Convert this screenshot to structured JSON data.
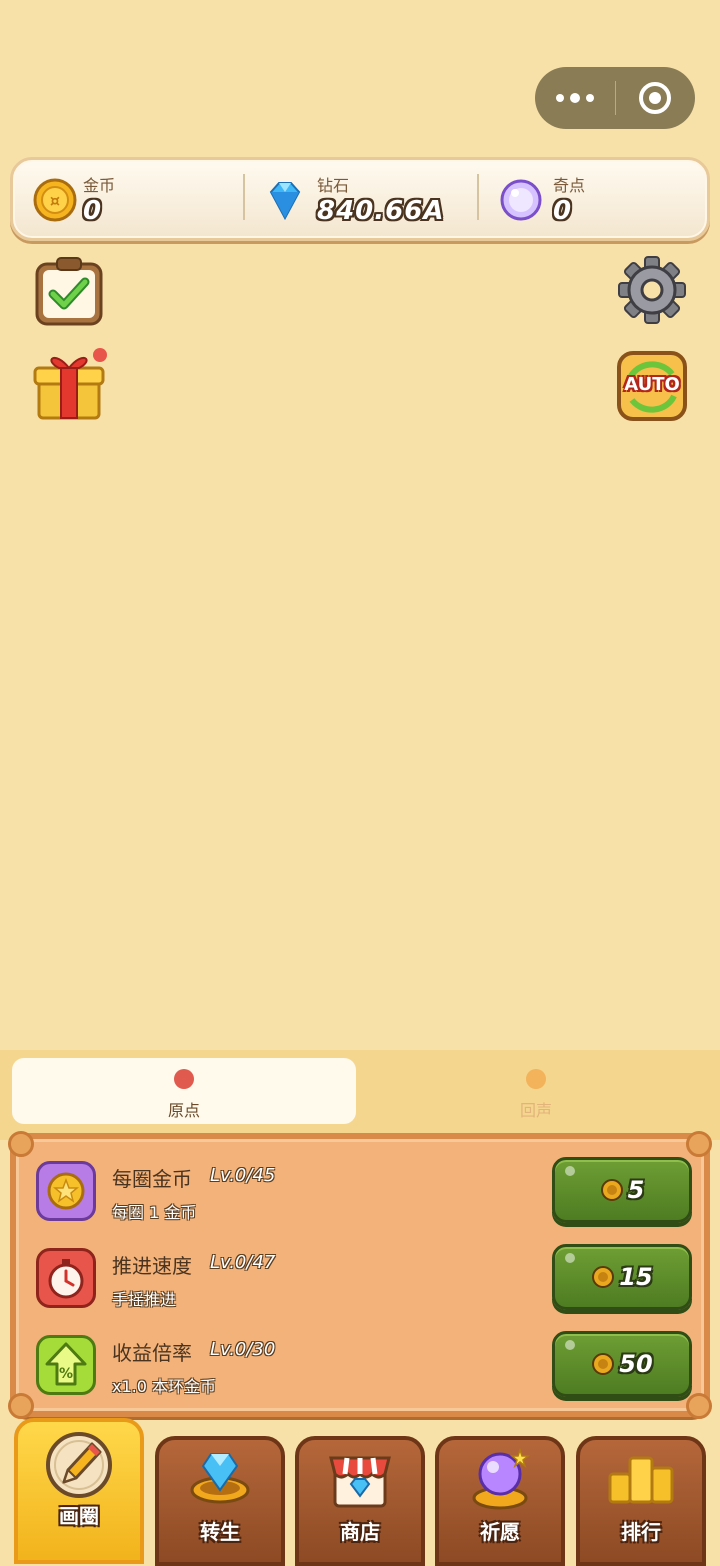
{
  "top_bar": {
    "more_icon": "more-dots-icon",
    "close_icon": "target-circle-icon"
  },
  "resources": [
    {
      "label": "金币",
      "value": "0",
      "icon": "gold-coin-icon"
    },
    {
      "label": "钻石",
      "value": "840.66A",
      "icon": "diamond-icon"
    },
    {
      "label": "奇点",
      "value": "0",
      "icon": "purple-orb-icon"
    }
  ],
  "side_buttons": {
    "tasks_icon": "clipboard-check-icon",
    "gift_icon": "gift-box-icon",
    "settings_icon": "gear-icon",
    "auto_icon": "auto-icon",
    "auto_text": "AUTO"
  },
  "tabs": [
    {
      "label": "原点",
      "dot_color": "#e05a4e",
      "active": true
    },
    {
      "label": "回声",
      "dot_color": "#f0a640",
      "active": false
    }
  ],
  "upgrades": [
    {
      "name": "每圈金币",
      "level": "Lv.0/45",
      "desc": "每圈 1 金币",
      "cost": "5",
      "icon": "coin-star-icon"
    },
    {
      "name": "推进速度",
      "level": "Lv.0/47",
      "desc": "手摇推进",
      "cost": "15",
      "icon": "stopwatch-icon"
    },
    {
      "name": "收益倍率",
      "level": "Lv.0/30",
      "desc": "x1.0 本环金币",
      "cost": "50",
      "icon": "percent-arrow-icon"
    }
  ],
  "nav": [
    {
      "label": "画圈",
      "icon": "pencil-circle-icon",
      "active": true
    },
    {
      "label": "转生",
      "icon": "diamond-ring-icon",
      "active": false
    },
    {
      "label": "商店",
      "icon": "shop-icon",
      "active": false
    },
    {
      "label": "祈愿",
      "icon": "crystal-ball-icon",
      "active": false
    },
    {
      "label": "排行",
      "icon": "podium-icon",
      "active": false
    }
  ]
}
